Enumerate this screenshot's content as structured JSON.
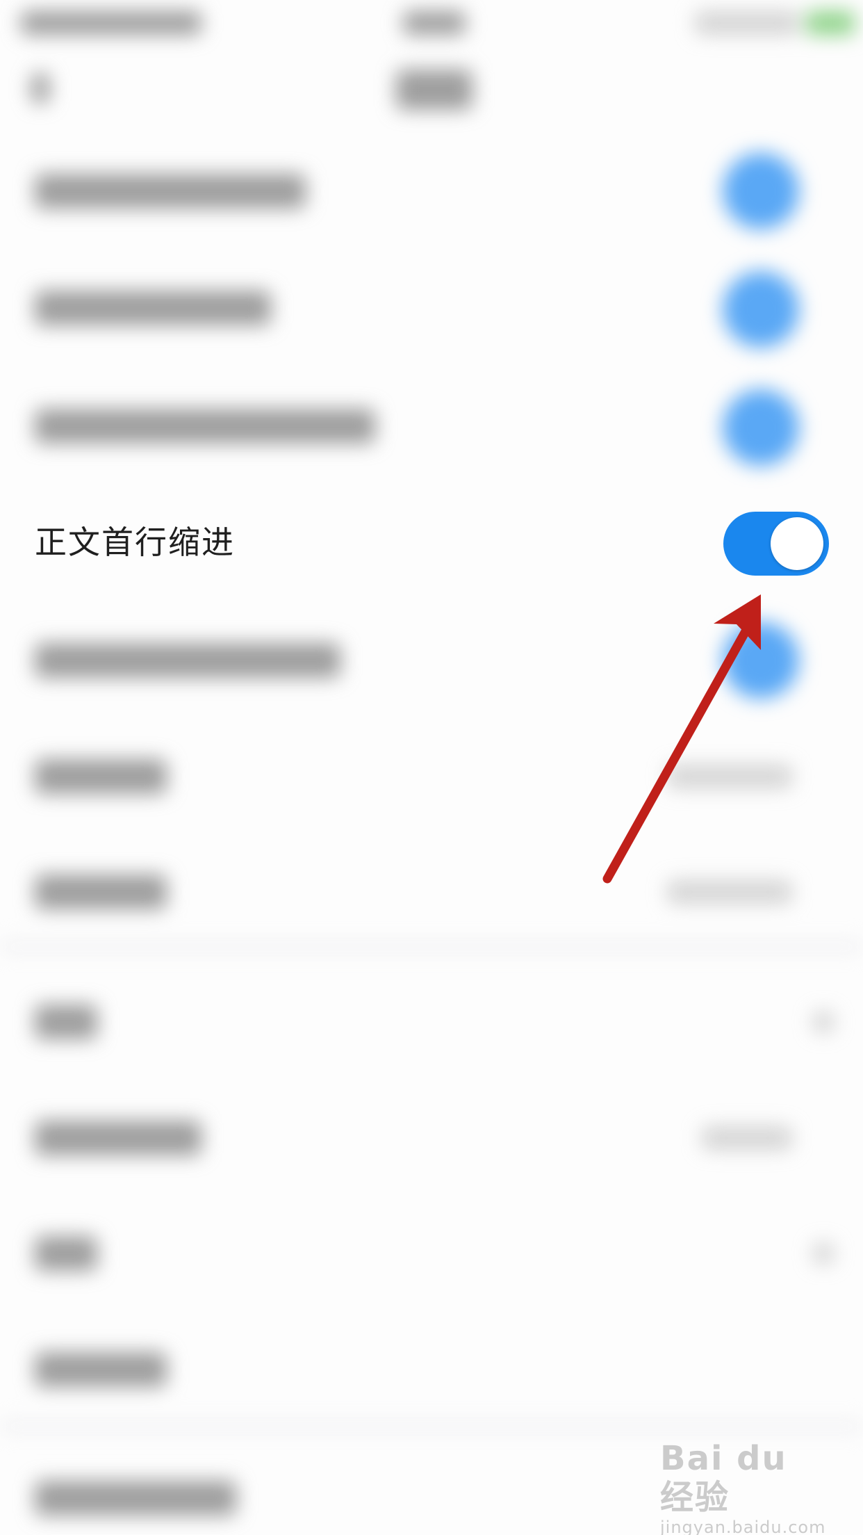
{
  "settings": {
    "visible_row": {
      "label": "正文首行缩进",
      "toggle_on": true
    },
    "accent_color": "#1a87ee"
  },
  "annotation": {
    "arrow_color": "#c0201a",
    "icon": "arrow-icon"
  },
  "watermark": {
    "brand": "Bai du 经验",
    "url": "jingyan.baidu.com"
  }
}
